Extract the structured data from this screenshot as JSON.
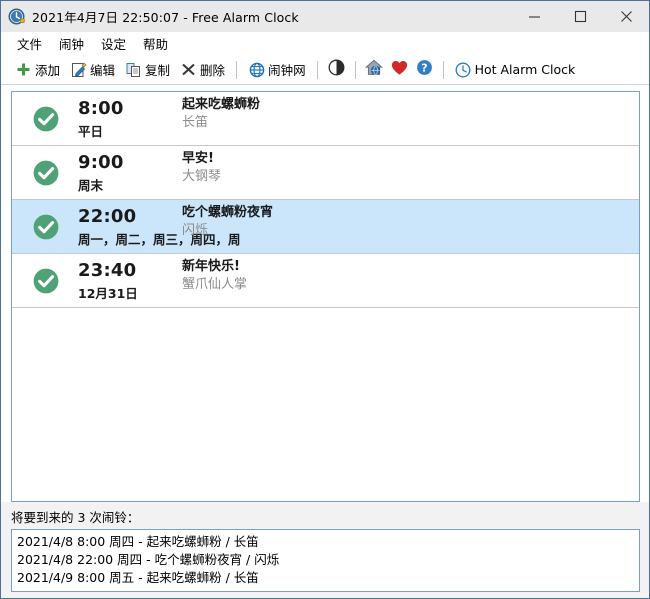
{
  "window": {
    "title": "2021年4月7日 22:50:07 - Free Alarm Clock",
    "icon": "clock-bell-icon",
    "minimize_label": "—",
    "maximize_label": "□",
    "close_label": "✕",
    "border_color": "#4c7099",
    "titlebar_bg": "#e9e9e9"
  },
  "menubar": {
    "items": [
      {
        "label": "文件",
        "name": "menu-file"
      },
      {
        "label": "闹钟",
        "name": "menu-alarm"
      },
      {
        "label": "设定",
        "name": "menu-settings"
      },
      {
        "label": "帮助",
        "name": "menu-help"
      }
    ]
  },
  "toolbar": {
    "add_label": "添加",
    "edit_label": "编辑",
    "copy_label": "复制",
    "delete_label": "删除",
    "web_label": "闹钟网",
    "hot_alarm_label": "Hot Alarm Clock",
    "icons": {
      "add": "plus-icon",
      "edit": "pencil-edit-icon",
      "copy": "copy-pages-icon",
      "delete": "x-delete-icon",
      "web": "globe-icon",
      "contrast": "contrast-circle-icon",
      "home": "home-globe-icon",
      "favorite": "heart-icon",
      "help": "question-help-icon",
      "hot_alarm": "clock-icon"
    },
    "accent_green": "#3f9c45",
    "accent_blue": "#1a6fb5",
    "accent_red": "#d02a28"
  },
  "alarms": {
    "enabled_icon": "green-check-circle-icon",
    "rows": [
      {
        "time": "8:00",
        "days": "平日",
        "title": "起来吃螺蛳粉",
        "sound": "长笛",
        "enabled": true,
        "selected": false
      },
      {
        "time": "9:00",
        "days": "周末",
        "title": "早安!",
        "sound": "大钢琴",
        "enabled": true,
        "selected": false
      },
      {
        "time": "22:00",
        "days": "周一，周二，周三，周四，周",
        "title": "吃个螺蛳粉夜宵",
        "sound": "闪烁",
        "enabled": true,
        "selected": true
      },
      {
        "time": "23:40",
        "days": "12月31日",
        "title": "新年快乐!",
        "sound": "蟹爪仙人掌",
        "enabled": true,
        "selected": false
      }
    ]
  },
  "upcoming": {
    "label": "将要到来的 3 次闹铃：",
    "items": [
      "2021/4/8 8:00 周四 - 起来吃螺蛳粉 / 长笛",
      "2021/4/8 22:00 周四 - 吃个螺蛳粉夜宵 / 闪烁",
      "2021/4/9 8:00 周五 - 起来吃螺蛳粉 / 长笛"
    ]
  }
}
